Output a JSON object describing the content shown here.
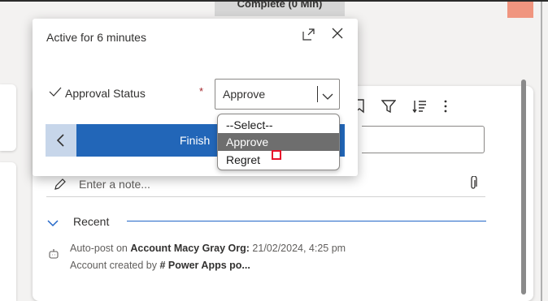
{
  "background": {
    "stage_header": "Complete  (0 Min)"
  },
  "timeline": {
    "note_placeholder": "Enter a note...",
    "recent_label": "Recent",
    "post": {
      "prefix": "Auto-post on ",
      "record": "Account Macy Gray Org:",
      "timestamp": "21/02/2024, 4:25 pm",
      "line2_prefix": "Account created by ",
      "line2_creator": "# Power Apps po..."
    },
    "toolbar_icons": [
      "bookmark-icon",
      "filter-icon",
      "sort-icon",
      "more-icon"
    ]
  },
  "flyout": {
    "title": "Active for 6 minutes",
    "field": {
      "label": "Approval Status",
      "required_mark": "*",
      "value": "Approve"
    },
    "finish_label": "Finish"
  },
  "dropdown": {
    "options": [
      "--Select--",
      "Approve",
      "Regret"
    ],
    "selected": "Approve"
  },
  "colors": {
    "accent": "#2266b8",
    "required": "#a4262c",
    "highlight": "#6e6e6e",
    "marker": "#e8102b"
  }
}
